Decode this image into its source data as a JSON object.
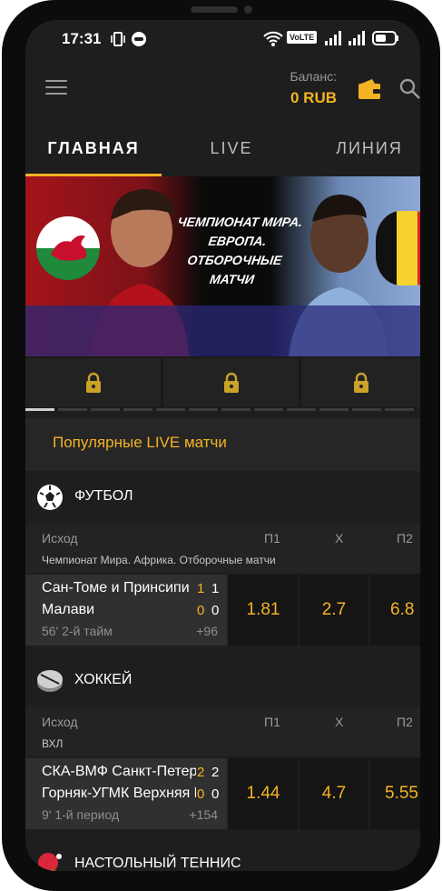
{
  "status": {
    "time": "17:31",
    "volte": "VoLTE"
  },
  "header": {
    "balance_label": "Баланс:",
    "balance_value": "0 RUB"
  },
  "tabs": [
    {
      "label": "ГЛАВНАЯ",
      "active": true
    },
    {
      "label": "LIVE",
      "active": false
    },
    {
      "label": "ЛИНИЯ",
      "active": false
    }
  ],
  "banner": {
    "text": "ЧЕМПИОНАТ МИРА. ЕВРОПА. ОТБОРОЧНЫЕ МАТЧИ"
  },
  "popular": {
    "label": "Популярные LIVE матчи"
  },
  "sections": [
    {
      "sport": "ФУТБОЛ",
      "icon": "soccer-ball-icon",
      "cols": {
        "outcome": "Исход",
        "p1": "П1",
        "x": "Х",
        "p2": "П2"
      },
      "league": "Чемпионат Мира. Африка. Отборочные матчи",
      "match": {
        "team1": "Сан-Томе и Принсипи",
        "team2": "Малави",
        "score1a": "1",
        "score1b": "1",
        "score2a": "0",
        "score2b": "0",
        "period": "56' 2-й тайм",
        "more": "+96",
        "odds": [
          "1.81",
          "2.7",
          "6.8"
        ]
      }
    },
    {
      "sport": "ХОККЕЙ",
      "icon": "hockey-puck-icon",
      "cols": {
        "outcome": "Исход",
        "p1": "П1",
        "x": "Х",
        "p2": "П2"
      },
      "league": "ВХЛ",
      "match": {
        "team1": "СКА-ВМФ Санкт-Петербург",
        "team2": "Горняк-УГМК Верхняя Пышма",
        "score1a": "2",
        "score1b": "2",
        "score2a": "0",
        "score2b": "0",
        "period": "9' 1-й период",
        "more": "+154",
        "odds": [
          "1.44",
          "4.7",
          "5.55"
        ]
      }
    },
    {
      "sport": "НАСТОЛЬНЫЙ ТЕННИС",
      "icon": "table-tennis-icon"
    }
  ],
  "colors": {
    "accent": "#f4b324",
    "background": "#1e1e1e"
  }
}
